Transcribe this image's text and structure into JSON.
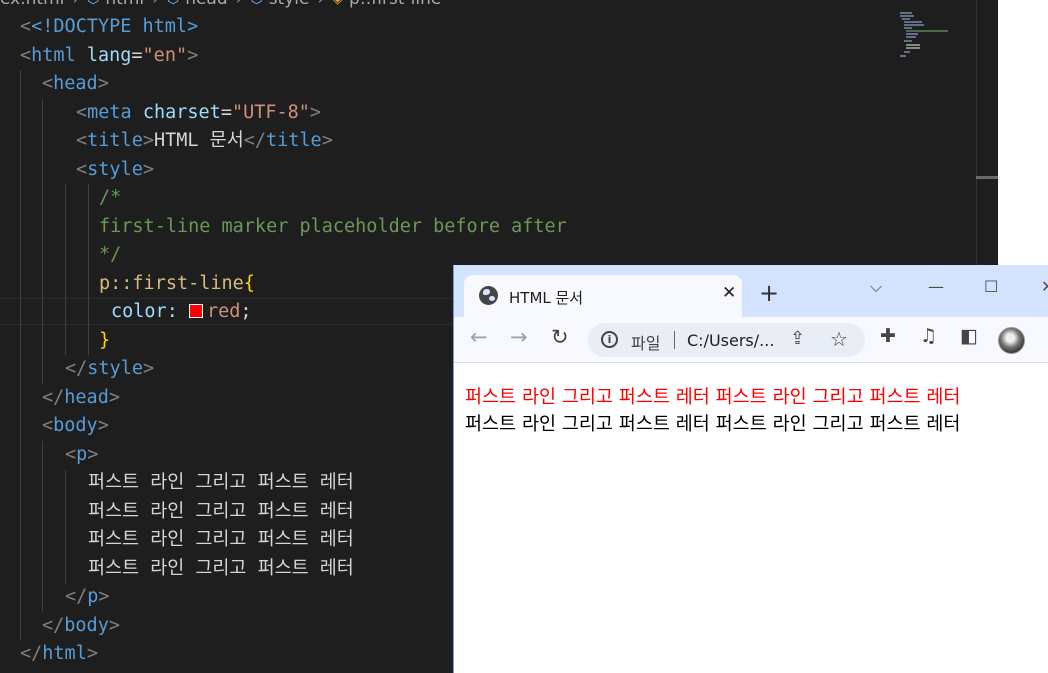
{
  "editor": {
    "breadcrumb": [
      "ex.html",
      "html",
      "head",
      "style",
      "p::first-line"
    ],
    "lines": {
      "l1": "<!DOCTYPE html>",
      "l2_lang": "\"en\"",
      "l4_charset": "\"UTF-8\"",
      "l5_title": "HTML 문서",
      "l7": "/*",
      "l8": "first-line marker placeholder before after",
      "l9": "*/",
      "l10": "p::first-line",
      "l11_prop": "color:",
      "l11_val": "red",
      "p_text": "퍼스트 라인 그리고 퍼스트 레터"
    },
    "colors": {
      "swatch": "#ff0000",
      "background": "#1e1e1e"
    }
  },
  "browser": {
    "tab_title": "HTML 문서",
    "tab_icon": "globe-icon",
    "new_tab": "+",
    "window_controls": {
      "dropdown": "⌵",
      "minimize": "—",
      "maximize": "☐",
      "close": "✕"
    },
    "address": {
      "scheme": "파일",
      "url": "C:/Users/..."
    },
    "page_lines": {
      "first": "퍼스트 라인 그리고 퍼스트 레터 퍼스트 라인 그리고 퍼스트 레터",
      "second": "퍼스트 라인 그리고 퍼스트 레터 퍼스트 라인 그리고 퍼스트 레터"
    },
    "colors": {
      "first_line": "#ff0000",
      "tabbar": "#d3e3fd"
    }
  }
}
